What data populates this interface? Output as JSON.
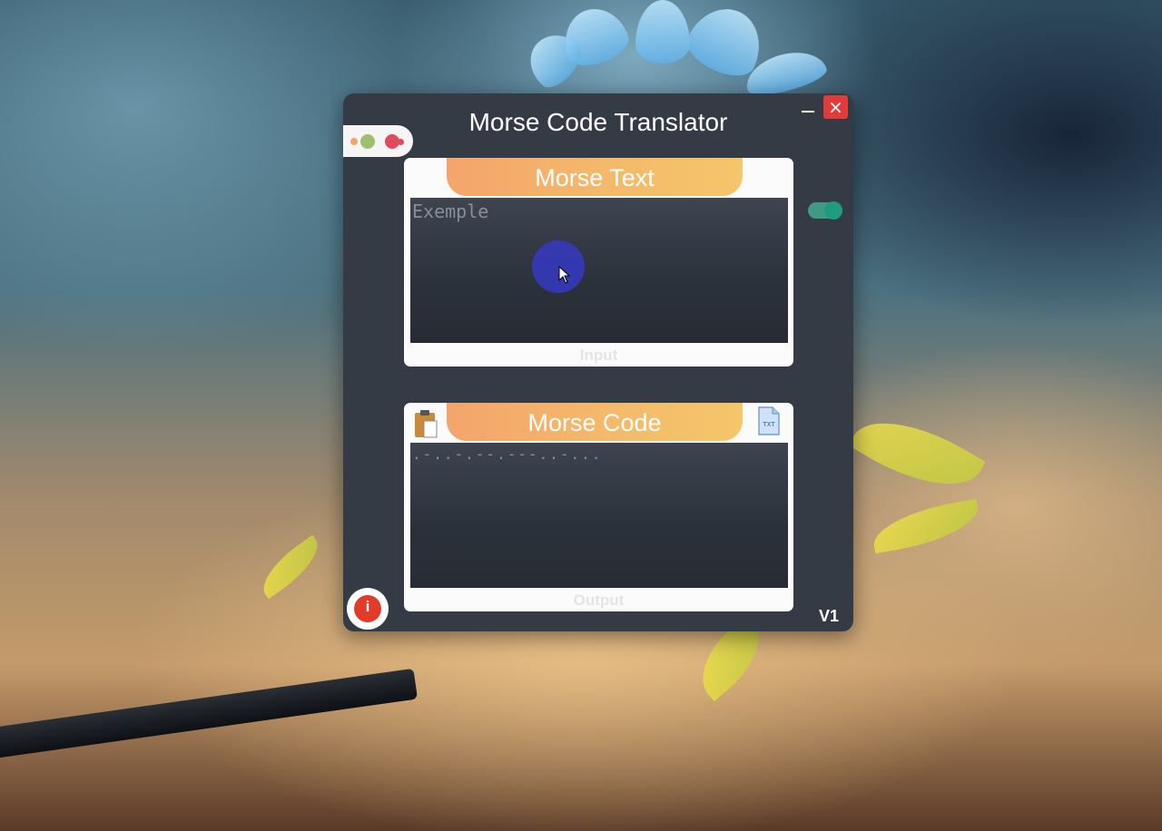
{
  "window": {
    "title": "Morse Code Translator",
    "minimize_label": "",
    "close_label": "×",
    "version": "V1"
  },
  "status_dots": {
    "colors": [
      "#f4a46c",
      "#9fbf6c",
      "#e04a5a"
    ]
  },
  "toggle": {
    "on": true,
    "color": "#1f9c7f"
  },
  "input_panel": {
    "header": "Morse Text",
    "placeholder": "Exemple",
    "value": "",
    "caption": "Input"
  },
  "output_panel": {
    "header": "Morse Code",
    "value": ".-..-.--.---..-...",
    "caption": "Output",
    "copy_icon": "clipboard-icon",
    "export_icon": "txt-file-icon"
  },
  "info_button": {
    "label": "i",
    "icon": "info-icon"
  },
  "colors": {
    "window_bg": "#353b45",
    "panel_bg": "#fbfbfb",
    "header_gradient_start": "#f4a46c",
    "header_gradient_end": "#f5c66a",
    "close_red": "#e23b3b",
    "cursor_highlight": "#3538b8"
  }
}
